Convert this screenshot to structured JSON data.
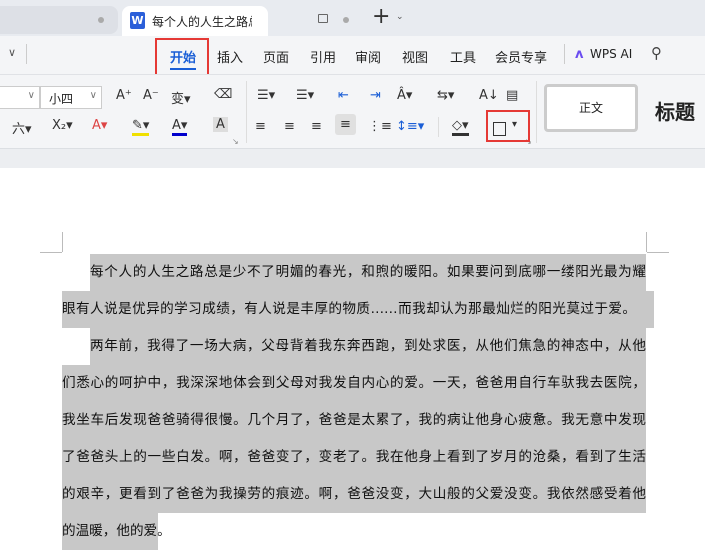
{
  "tabs": {
    "active_title": "每个人的人生之路总是少不了明媚的春光，和煦的暖阳",
    "new_tab": "+"
  },
  "menu": [
    "开始",
    "插入",
    "页面",
    "引用",
    "审阅",
    "视图",
    "工具",
    "会员专享"
  ],
  "wps_ai": "WPS AI",
  "toolbar": {
    "font_size": "小四",
    "styles": [
      "正文",
      "标题"
    ]
  },
  "document": {
    "lines": [
      "每个人的人生之路总是少不了明媚的春光，和煦的暖阳。如果要问到底哪一缕阳光最为耀",
      "眼有人说是优异的学习成绩，有人说是丰厚的物质……而我却认为那最灿烂的阳光莫过于爱。",
      "两年前，我得了一场大病，父母背着我东奔西跑，到处求医，从他们焦急的神态中，从他",
      "们悉心的呵护中，我深深地体会到父母对我发自内心的爱。一天，爸爸用自行车驮我去医院，",
      "我坐车后发现爸爸骑得很慢。几个月了，爸爸是太累了，我的病让他身心疲惫。我无意中发现",
      "了爸爸头上的一些白发。啊，爸爸变了，变老了。我在他身上看到了岁月的沧桑，看到了生活",
      "的艰辛，更看到了爸爸为我操劳的痕迹。啊，爸爸没变，大山般的父爱没变。我依然感受着他",
      "的温暖，他的爱。"
    ]
  }
}
